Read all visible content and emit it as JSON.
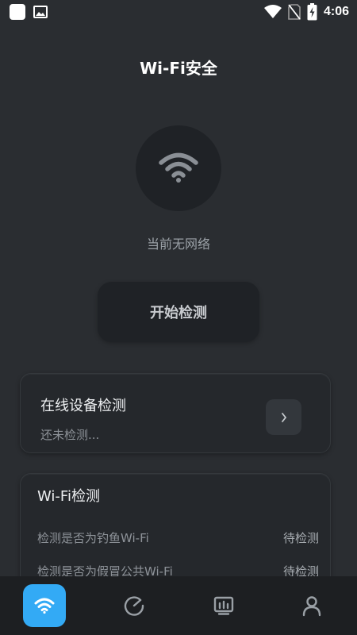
{
  "status_bar": {
    "time": "4:06",
    "icons": [
      "app-square-icon",
      "image-icon",
      "wifi-signal-icon",
      "no-sim-icon",
      "battery-charging-icon"
    ]
  },
  "header": {
    "title": "Wi-Fi安全"
  },
  "network": {
    "icon": "wifi-icon",
    "status_text": "当前无网络"
  },
  "start_button": {
    "label": "开始检测"
  },
  "online_devices": {
    "title": "在线设备检测",
    "subtitle": "还未检测...",
    "arrow": "›"
  },
  "wifi_check": {
    "title": "Wi-Fi检测",
    "rows": [
      {
        "label": "检测是否为钓鱼Wi-Fi",
        "status": "待检测"
      },
      {
        "label": "检测是否为假冒公共Wi-Fi",
        "status": "待检测"
      }
    ]
  },
  "bottom_nav": {
    "items": [
      {
        "name": "wifi-icon",
        "active": true
      },
      {
        "name": "speed-dial-icon",
        "active": false
      },
      {
        "name": "dashboard-icon",
        "active": false
      },
      {
        "name": "user-icon",
        "active": false
      }
    ],
    "active_color": "#33aaf5"
  },
  "colors": {
    "background": "#2a2d31",
    "card": "#25282c",
    "accent": "#33aaf5"
  }
}
